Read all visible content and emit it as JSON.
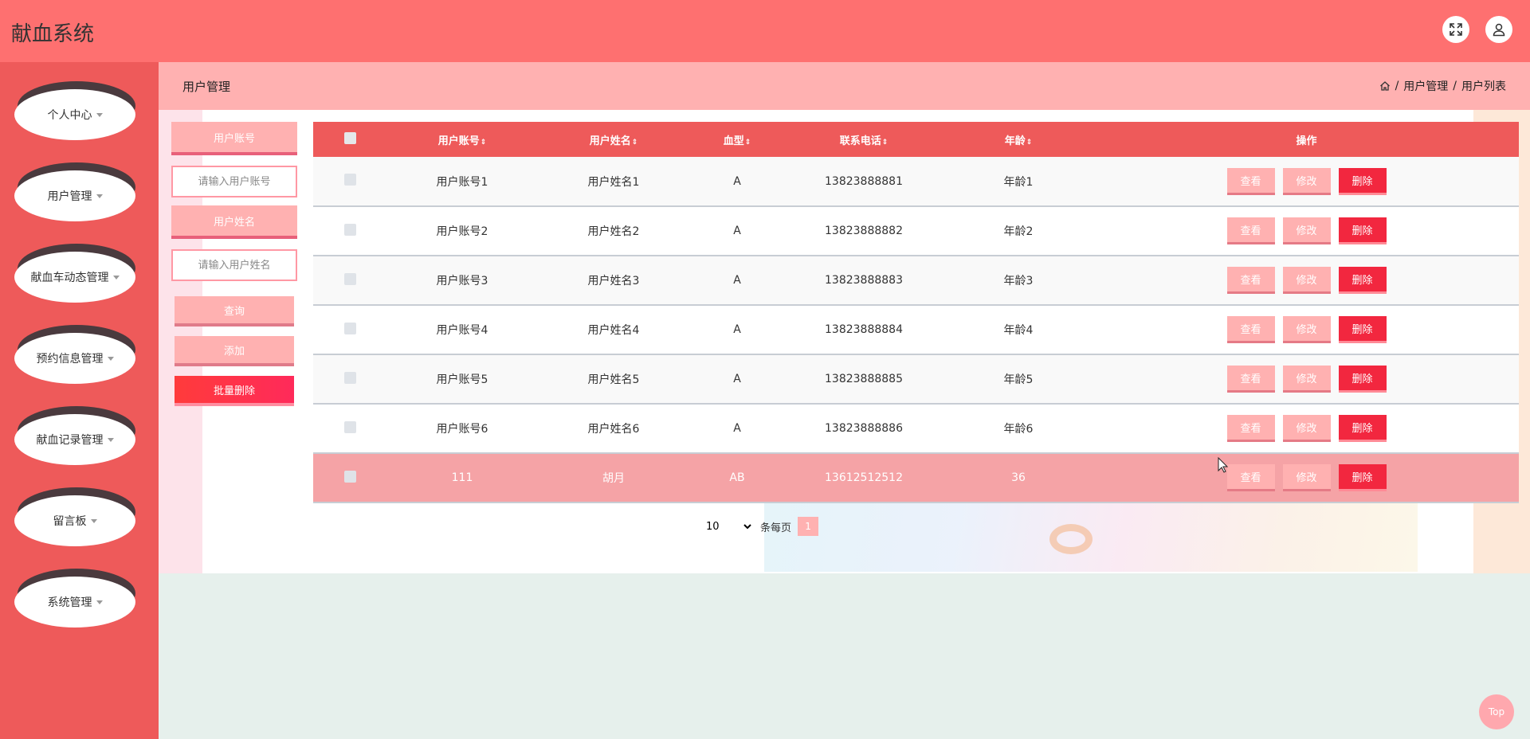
{
  "header": {
    "app_title": "献血系统"
  },
  "sidebar": {
    "items": [
      {
        "label": "个人中心"
      },
      {
        "label": "用户管理"
      },
      {
        "label": "献血车动态管理"
      },
      {
        "label": "预约信息管理"
      },
      {
        "label": "献血记录管理"
      },
      {
        "label": "留言板"
      },
      {
        "label": "系统管理"
      }
    ]
  },
  "breadcrumb": {
    "page_title": "用户管理",
    "crumbs": [
      "用户管理",
      "用户列表"
    ],
    "separator": "/"
  },
  "search": {
    "account_label": "用户账号",
    "account_placeholder": "请输入用户账号",
    "name_label": "用户姓名",
    "name_placeholder": "请输入用户姓名",
    "query_label": "查询",
    "add_label": "添加",
    "batch_delete_label": "批量删除"
  },
  "table": {
    "columns": [
      "用户账号",
      "用户姓名",
      "血型",
      "联系电话",
      "年龄",
      "操作"
    ],
    "sort_glyph": "⇕",
    "rows": [
      {
        "account": "用户账号1",
        "name": "用户姓名1",
        "blood": "A",
        "phone": "13823888881",
        "age": "年龄1"
      },
      {
        "account": "用户账号2",
        "name": "用户姓名2",
        "blood": "A",
        "phone": "13823888882",
        "age": "年龄2"
      },
      {
        "account": "用户账号3",
        "name": "用户姓名3",
        "blood": "A",
        "phone": "13823888883",
        "age": "年龄3"
      },
      {
        "account": "用户账号4",
        "name": "用户姓名4",
        "blood": "A",
        "phone": "13823888884",
        "age": "年龄4"
      },
      {
        "account": "用户账号5",
        "name": "用户姓名5",
        "blood": "A",
        "phone": "13823888885",
        "age": "年龄5"
      },
      {
        "account": "用户账号6",
        "name": "用户姓名6",
        "blood": "A",
        "phone": "13823888886",
        "age": "年龄6"
      },
      {
        "account": "111",
        "name": "胡月",
        "blood": "AB",
        "phone": "13612512512",
        "age": "36"
      }
    ],
    "view_label": "查看",
    "edit_label": "修改",
    "delete_label": "删除"
  },
  "pagination": {
    "page_size": "10",
    "per_page_label": "条每页",
    "current_page": "1"
  },
  "top_button_label": "Top",
  "colors": {
    "header_bg": "#fe7070",
    "sidebar_bg": "#ee5a5a",
    "accent_light": "#ffb1b1",
    "delete_red": "#f2273f"
  }
}
